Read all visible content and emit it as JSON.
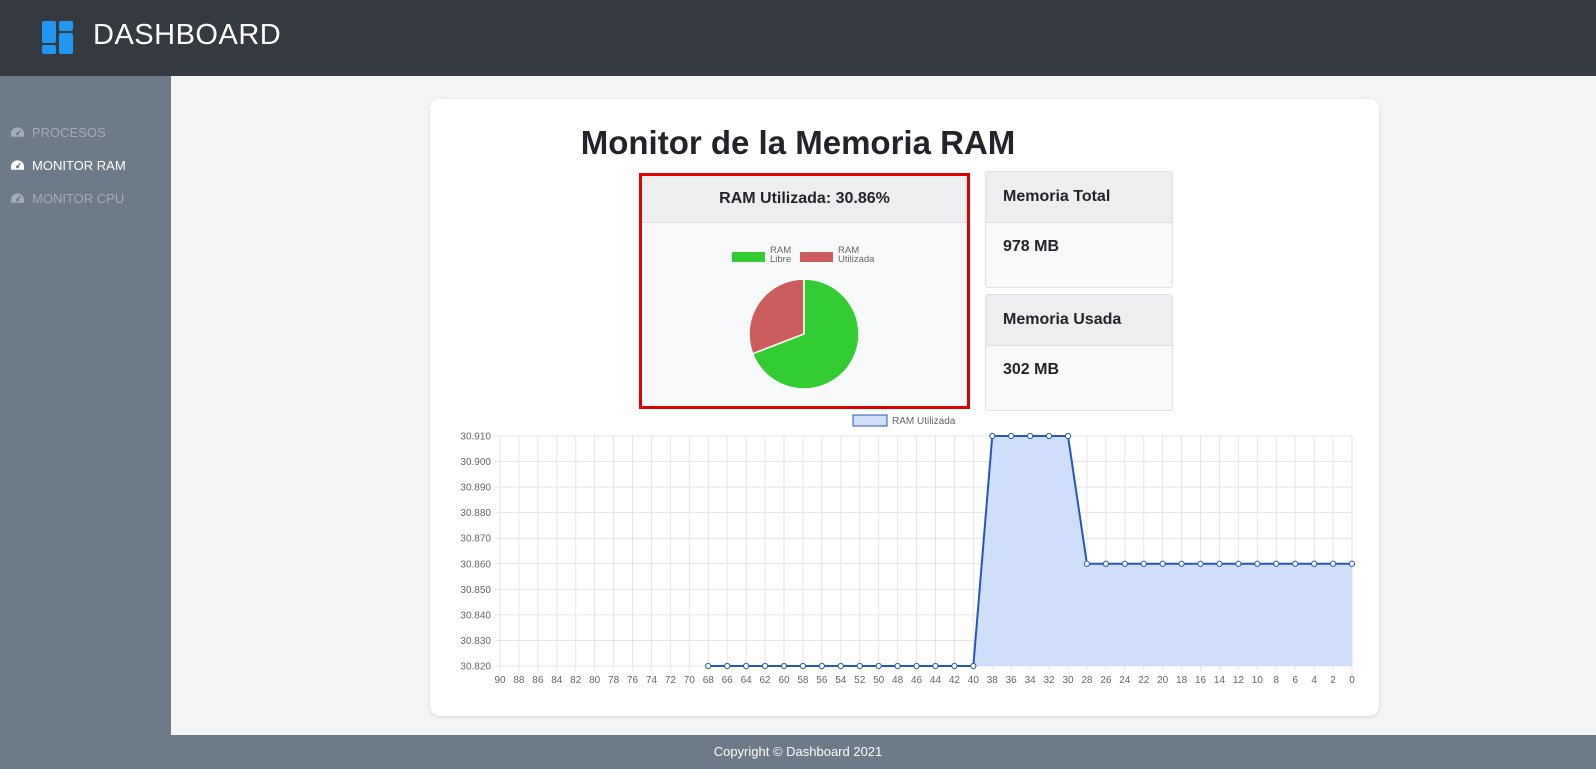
{
  "header": {
    "title": "DASHBOARD"
  },
  "sidebar": {
    "items": [
      {
        "label": "PROCESOS",
        "icon": "gauge-icon",
        "active": false
      },
      {
        "label": "MONITOR RAM",
        "icon": "gauge-icon",
        "active": true
      },
      {
        "label": "MONITOR CPU",
        "icon": "gauge-icon",
        "active": false
      }
    ]
  },
  "main": {
    "title": "Monitor de la Memoria RAM",
    "ram_used_label": "RAM Utilizada: 30.86%",
    "total": {
      "label": "Memoria Total",
      "value": "978 MB"
    },
    "used": {
      "label": "Memoria Usada",
      "value": "302 MB"
    }
  },
  "footer": {
    "text": "Copyright © Dashboard 2021"
  },
  "colors": {
    "header_bg": "#343a40",
    "sidebar_bg": "#6c7a89",
    "pie_free": "#33cc33",
    "pie_used": "#cd5c5c",
    "line": "#2457b8",
    "area": "#cfdffb",
    "highlight_border": "#e00000"
  },
  "chart_data": [
    {
      "type": "pie",
      "legend": [
        "RAM Libre",
        "RAM Utilizada"
      ],
      "values": [
        69.14,
        30.86
      ],
      "legend_position": "top"
    },
    {
      "type": "area",
      "series": [
        {
          "name": "RAM Utilizada"
        }
      ],
      "x_ticks": [
        90,
        88,
        86,
        84,
        82,
        80,
        78,
        76,
        74,
        72,
        70,
        68,
        66,
        64,
        62,
        60,
        58,
        56,
        54,
        52,
        50,
        48,
        46,
        44,
        42,
        40,
        38,
        36,
        34,
        32,
        30,
        28,
        26,
        24,
        22,
        20,
        18,
        16,
        14,
        12,
        10,
        8,
        6,
        4,
        2,
        0
      ],
      "x": [
        68,
        66,
        64,
        62,
        60,
        58,
        56,
        54,
        52,
        50,
        48,
        46,
        44,
        42,
        40,
        38,
        36,
        34,
        32,
        30,
        28,
        26,
        24,
        22,
        20,
        18,
        16,
        14,
        12,
        10,
        8,
        6,
        4,
        2,
        0
      ],
      "y": [
        30.82,
        30.82,
        30.82,
        30.82,
        30.82,
        30.82,
        30.82,
        30.82,
        30.82,
        30.82,
        30.82,
        30.82,
        30.82,
        30.82,
        30.82,
        30.91,
        30.91,
        30.91,
        30.91,
        30.91,
        30.86,
        30.86,
        30.86,
        30.86,
        30.86,
        30.86,
        30.86,
        30.86,
        30.86,
        30.86,
        30.86,
        30.86,
        30.86,
        30.86,
        30.86
      ],
      "y_ticks": [
        "30.910",
        "30.900",
        "30.890",
        "30.880",
        "30.870",
        "30.860",
        "30.850",
        "30.840",
        "30.830",
        "30.820"
      ],
      "ylim": [
        30.82,
        30.91
      ],
      "xlim": [
        90,
        0
      ],
      "grid": true,
      "legend_position": "top"
    }
  ]
}
